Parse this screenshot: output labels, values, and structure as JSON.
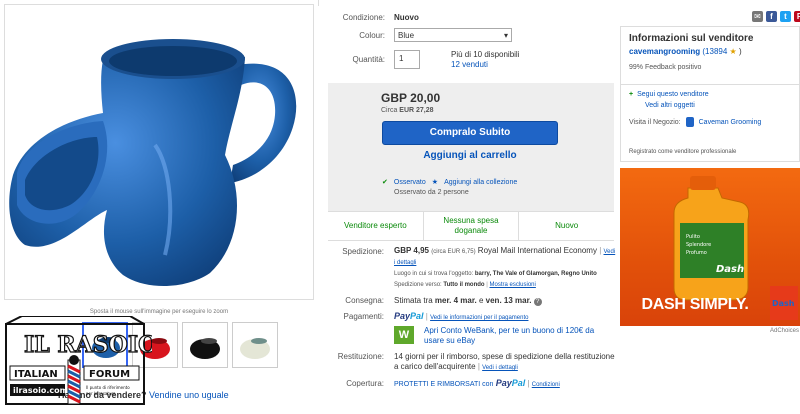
{
  "image": {
    "hint": "Sposta il mouse sull'immagine per eseguire lo zoom"
  },
  "sell": {
    "question": "Hai uno da vendere?",
    "link": "Vendine uno uguale"
  },
  "logo": {
    "title": "IL RASOIO",
    "sub": "ITALIAN FORUM",
    "url": "ilrasoio.com",
    "tagline": "Il punto di riferimento per la rasatura"
  },
  "item": {
    "condizione_label": "Condizione:",
    "condizione_value": "Nuovo",
    "colour_label": "Colour:",
    "colour_value": "Blue",
    "quantita_label": "Quantità:",
    "quantita_value": "1",
    "disponibili": "Più di 10 disponibili",
    "venduti": "12 venduti"
  },
  "buybox": {
    "price": "GBP 20,00",
    "approx_prefix": "Circa",
    "approx_value": "EUR 27,28",
    "buy_label": "Compralo Subito",
    "cart_label": "Aggiungi al carrello",
    "watched_label": "Osservato",
    "add_collection": "Aggiungi alla collezione",
    "watch_count": "Osservato da 2 persone"
  },
  "badges": [
    "Venditore esperto",
    "Nessuna spesa doganale",
    "Nuovo"
  ],
  "shipping": {
    "label": "Spedizione:",
    "price": "GBP 4,95",
    "approx": "(circa EUR 6,75)",
    "service": "Royal Mail International Economy",
    "details": "Vedi i dettagli",
    "location_label": "Luogo in cui si trova l'oggetto:",
    "location": "barry, The Vale of Glamorgan, Regno Unito",
    "to_label": "Spedizione verso:",
    "to": "Tutto il mondo",
    "exclusions": "Mostra esclusioni"
  },
  "delivery": {
    "label": "Consegna:",
    "text": "Stimata tra",
    "from": "mer. 4 mar.",
    "and": "e",
    "to": "ven. 13 mar."
  },
  "payments": {
    "label": "Pagamenti:",
    "paypal_a": "Pay",
    "paypal_b": "Pal",
    "info": "Vedi le informazioni per il pagamento",
    "webank_icon": "W",
    "webank_text": "Apri Conto WeBank, per te un buono di 120€ da usare su eBay"
  },
  "returns": {
    "label": "Restituzione:",
    "text": "14 giorni per il rimborso, spese di spedizione della restituzione a carico dell'acquirente",
    "details": "Vedi i dettagli"
  },
  "coverage": {
    "label": "Copertura:",
    "text": "PROTETTI E RIMBORSATI con",
    "paypal_a": "Pay",
    "paypal_b": "Pal",
    "conditions": "Condizioni"
  },
  "seller": {
    "title": "Informazioni sul venditore",
    "name": "cavemangrooming",
    "score": "(13894",
    "score_close": ")",
    "feedback": "99% Feedback positivo",
    "follow": "Segui questo venditore",
    "other_items": "Vedi altri oggetti",
    "store_label": "Visita il Negozio:",
    "store_name": "Caveman Grooming",
    "registered": "Registrato come venditore professionale"
  },
  "ad": {
    "brand": "Dash",
    "slogan": "DASH SIMPLY.",
    "choices": "AdChoices",
    "bullets": [
      "Pulito",
      "Splendore",
      "Profumo"
    ]
  },
  "colors": {
    "link": "#0654ba",
    "buy_button": "#1f64c6",
    "badge_green": "#0a8a0a",
    "ad_orange": "#f36a10",
    "mug_blue": "#1d5fa8"
  }
}
